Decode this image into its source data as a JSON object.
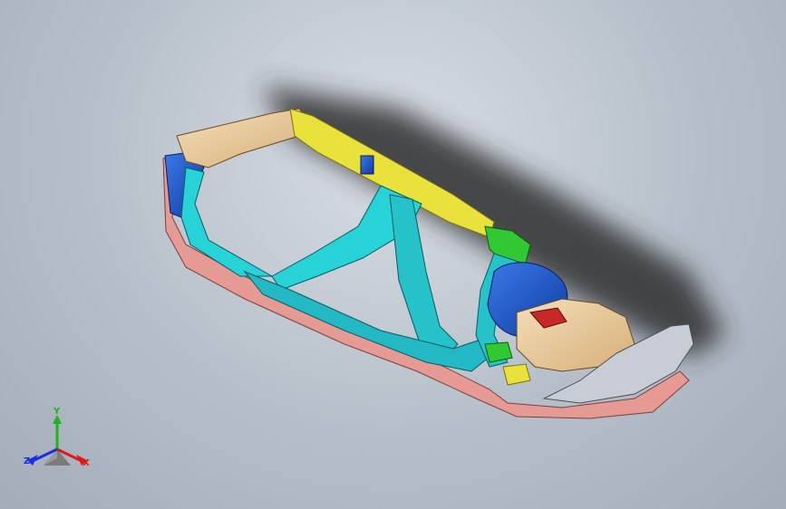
{
  "triad": {
    "y_label": "Y",
    "z_label": "Z",
    "x_label": "X",
    "colors": {
      "x": "#e01818",
      "y": "#18b818",
      "z": "#1830e0"
    }
  },
  "model": {
    "icon": "front-end-carrier-model-icon",
    "palette": {
      "frame_pink": "#e59a94",
      "yellow": "#e9e23c",
      "cyan": "#28d3d8",
      "blue": "#1848c8",
      "green": "#32c832",
      "tan": "#e8c89a",
      "gray": "#c8ccd4",
      "red": "#c82828",
      "shadow": "#2a2a2a"
    }
  },
  "background": {
    "top": "#d8dde4",
    "bottom": "#a3adb9"
  }
}
